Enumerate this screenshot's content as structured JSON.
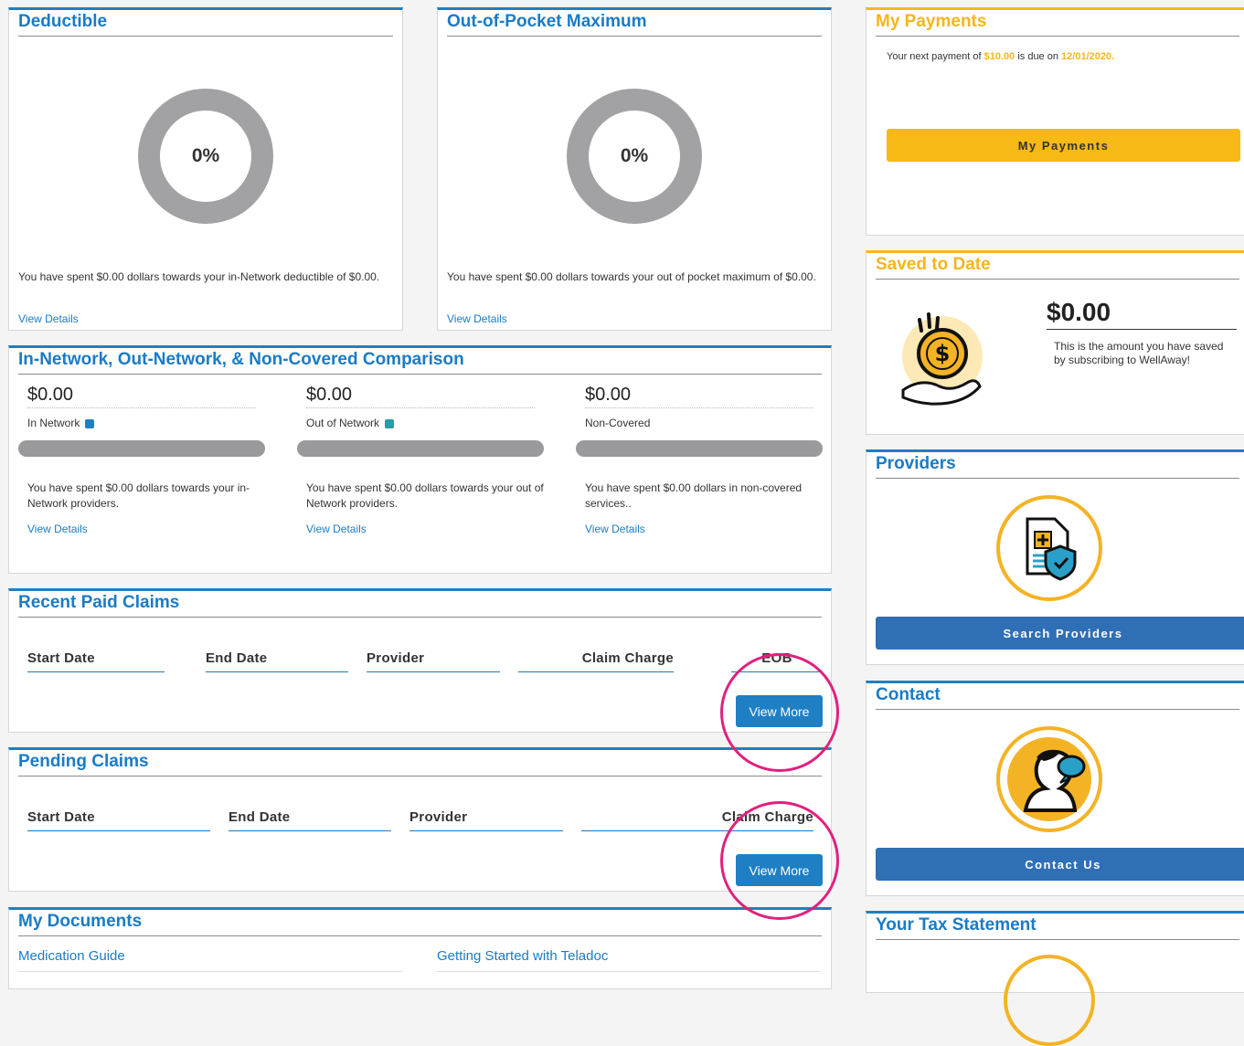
{
  "deductible": {
    "title": "Deductible",
    "percent": "0%",
    "text": "You have spent $0.00 dollars towards your in-Network deductible of $0.00.",
    "link": "View Details"
  },
  "oop": {
    "title": "Out-of-Pocket Maximum",
    "percent": "0%",
    "text": "You have spent $0.00 dollars towards your out of pocket maximum of $0.00.",
    "link": "View Details"
  },
  "comparison": {
    "title": "In-Network, Out-Network, & Non-Covered Comparison",
    "columns": [
      {
        "amount": "$0.00",
        "label": "In Network",
        "swatch": "#1f7fc4",
        "progress": 0,
        "text": "You have spent $0.00 dollars towards your in-Network providers.",
        "link": "View Details"
      },
      {
        "amount": "$0.00",
        "label": "Out of Network",
        "swatch": "#2a9ba8",
        "progress": 0,
        "text": "You have spent $0.00 dollars towards your out of Network providers.",
        "link": "View Details"
      },
      {
        "amount": "$0.00",
        "label": "Non-Covered",
        "progress": 0,
        "text": "You have spent $0.00 dollars in non-covered services..",
        "link": "View Details"
      }
    ]
  },
  "recent_claims": {
    "title": "Recent Paid Claims",
    "headers": [
      "Start Date",
      "End Date",
      "Provider",
      "Claim Charge",
      "EOB"
    ],
    "button": "View More"
  },
  "pending_claims": {
    "title": "Pending Claims",
    "headers": [
      "Start Date",
      "End Date",
      "Provider",
      "Claim Charge"
    ],
    "button": "View More"
  },
  "documents": {
    "title": "My Documents",
    "items": [
      "Medication Guide",
      "Getting Started with Teladoc"
    ]
  },
  "payments": {
    "title": "My Payments",
    "text_prefix": "Your next payment of ",
    "amount": "$10.00",
    "text_mid": " is due on ",
    "date": "12/01/2020.",
    "button": "My Payments"
  },
  "saved": {
    "title": "Saved to Date",
    "amount": "$0.00",
    "text": "This is the amount you have saved by subscribing to WellAway!",
    "icon": "coin-hand-icon"
  },
  "providers": {
    "title": "Providers",
    "button": "Search Providers",
    "icon": "medical-document-shield-icon"
  },
  "contact": {
    "title": "Contact",
    "button": "Contact Us",
    "icon": "person-chat-icon"
  },
  "tax": {
    "title": "Your Tax Statement"
  },
  "colors": {
    "accent_blue": "#1f7fc4",
    "accent_gold": "#f7b915",
    "highlight_magenta": "#e0217e"
  }
}
